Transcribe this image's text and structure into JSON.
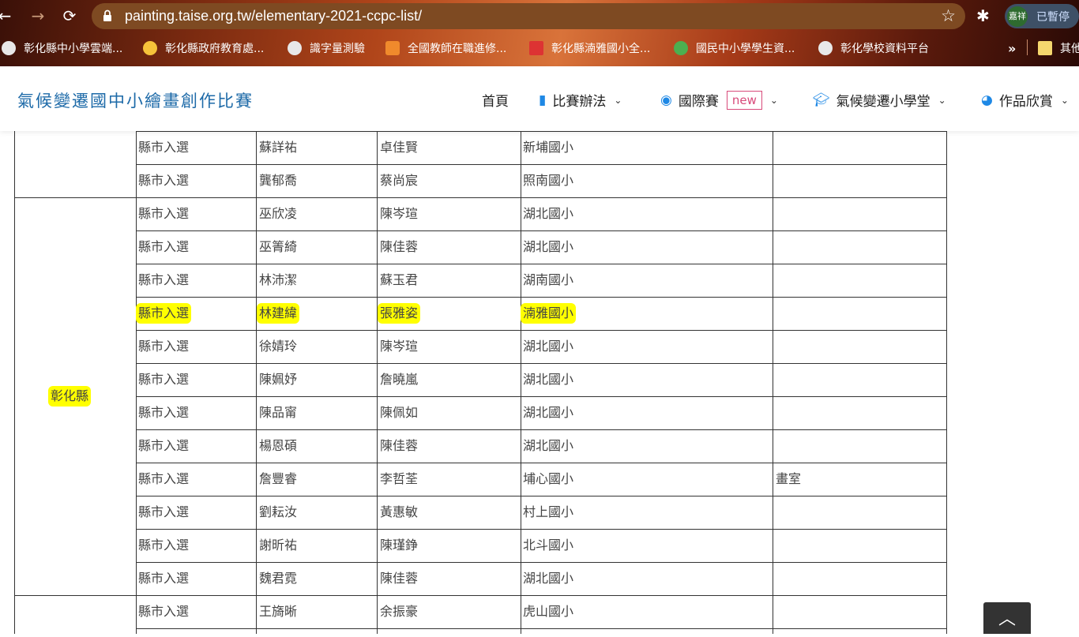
{
  "browser": {
    "url": "painting.taise.org.tw/elementary-2021-ccpc-list/",
    "profile_initials": "嘉祥",
    "profile_status": "已暫停",
    "bookmarks": [
      {
        "label": "彰化縣中小學雲端...",
        "icon": "globe-icon"
      },
      {
        "label": "彰化縣政府教育處...",
        "icon": "weather-icon"
      },
      {
        "label": "識字量測驗",
        "icon": "globe-icon"
      },
      {
        "label": "全國教師在職進修...",
        "icon": "person-icon"
      },
      {
        "label": "彰化縣湳雅國小全...",
        "icon": "school-icon"
      },
      {
        "label": "國民中小學學生資...",
        "icon": "sprout-icon"
      },
      {
        "label": "彰化學校資料平台",
        "icon": "globe-icon"
      }
    ],
    "more_label": "»",
    "other_label": "其他"
  },
  "site": {
    "logo": "氣候變遷國中小繪畫創作比賽",
    "nav": [
      {
        "label": "首頁"
      },
      {
        "label": "比賽辦法",
        "icon": "book-icon"
      },
      {
        "label": "國際賽",
        "icon": "globe-icon",
        "badge": "new"
      },
      {
        "label": "氣候變遷小學堂",
        "icon": "graduation-cap-icon"
      },
      {
        "label": "作品欣賞",
        "icon": "palette-icon"
      }
    ]
  },
  "table": {
    "county_label": "彰化縣",
    "rows": [
      {
        "award": "縣市入選",
        "student": "蘇詳祐",
        "teacher": "卓佳賢",
        "school": "新埔國小",
        "note": ""
      },
      {
        "award": "縣市入選",
        "student": "龔郁喬",
        "teacher": "蔡尚宸",
        "school": "照南國小",
        "note": ""
      },
      {
        "award": "縣市入選",
        "student": "巫欣凌",
        "teacher": "陳岑瑄",
        "school": "湖北國小",
        "note": ""
      },
      {
        "award": "縣市入選",
        "student": "巫箐綺",
        "teacher": "陳佳蓉",
        "school": "湖北國小",
        "note": ""
      },
      {
        "award": "縣市入選",
        "student": "林沛潔",
        "teacher": "蘇玉君",
        "school": "湖南國小",
        "note": ""
      },
      {
        "award": "縣市入選",
        "student": "林建緯",
        "teacher": "張雅姿",
        "school": "湳雅國小",
        "note": "",
        "highlight": true
      },
      {
        "award": "縣市入選",
        "student": "徐婧玲",
        "teacher": "陳岑瑄",
        "school": "湖北國小",
        "note": ""
      },
      {
        "award": "縣市入選",
        "student": "陳姵妤",
        "teacher": "詹曉嵐",
        "school": "湖北國小",
        "note": ""
      },
      {
        "award": "縣市入選",
        "student": "陳品甯",
        "teacher": "陳佩如",
        "school": "湖北國小",
        "note": ""
      },
      {
        "award": "縣市入選",
        "student": "楊恩碩",
        "teacher": "陳佳蓉",
        "school": "湖北國小",
        "note": ""
      },
      {
        "award": "縣市入選",
        "student": "詹豐睿",
        "teacher": "李哲荃",
        "school": "埔心國小",
        "note": "畫室"
      },
      {
        "award": "縣市入選",
        "student": "劉耘汝",
        "teacher": "黃惠敏",
        "school": "村上國小",
        "note": ""
      },
      {
        "award": "縣市入選",
        "student": "謝昕祐",
        "teacher": "陳瑾錚",
        "school": "北斗國小",
        "note": ""
      },
      {
        "award": "縣市入選",
        "student": "魏君霓",
        "teacher": "陳佳蓉",
        "school": "湖北國小",
        "note": ""
      },
      {
        "award": "縣市入選",
        "student": "王旖晰",
        "teacher": "余振豪",
        "school": "虎山國小",
        "note": ""
      }
    ]
  }
}
